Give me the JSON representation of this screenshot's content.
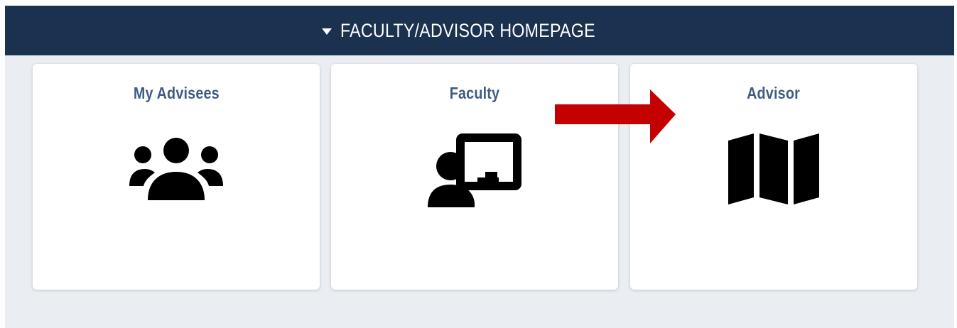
{
  "header": {
    "title": "FACULTY/ADVISOR HOMEPAGE",
    "toggle_icon": "caret-down-icon"
  },
  "tiles": [
    {
      "label": "My Advisees",
      "icon": "users-group-icon"
    },
    {
      "label": "Faculty",
      "icon": "teacher-at-board-icon"
    },
    {
      "label": "Advisor",
      "icon": "map-icon"
    }
  ],
  "annotation": {
    "icon": "arrow-right-icon",
    "color": "#c40000"
  },
  "colors": {
    "header_bg": "#1a314f",
    "page_bg": "#eaedf2",
    "tile_title": "#3f5d80"
  }
}
